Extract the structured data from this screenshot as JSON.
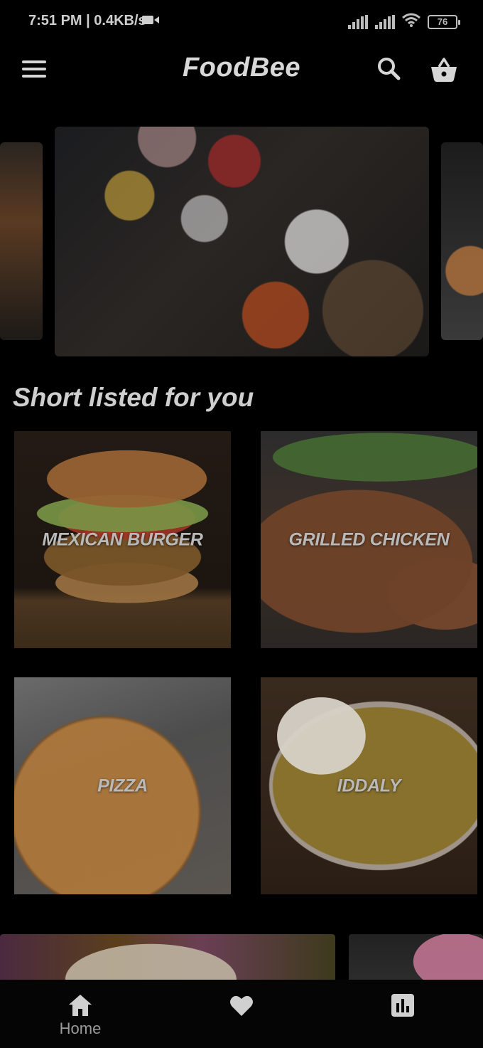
{
  "status_bar": {
    "time": "7:51 PM | 0.4KB/s",
    "battery": "76"
  },
  "app_bar": {
    "title": "FoodBee"
  },
  "section": {
    "title": "Short listed for you"
  },
  "food_items": [
    {
      "label": "MEXICAN BURGER"
    },
    {
      "label": "GRILLED CHICKEN"
    },
    {
      "label": "PIZZA"
    },
    {
      "label": "IDDALY"
    }
  ],
  "bottom_nav": {
    "items": [
      {
        "label": "Home",
        "icon": "home-icon"
      },
      {
        "label": "",
        "icon": "heart-icon"
      },
      {
        "label": "",
        "icon": "bar-chart-icon"
      }
    ]
  },
  "colors": {
    "background": "#000000",
    "text": "#d8d8d8",
    "muted_text": "#9a9a9a"
  }
}
